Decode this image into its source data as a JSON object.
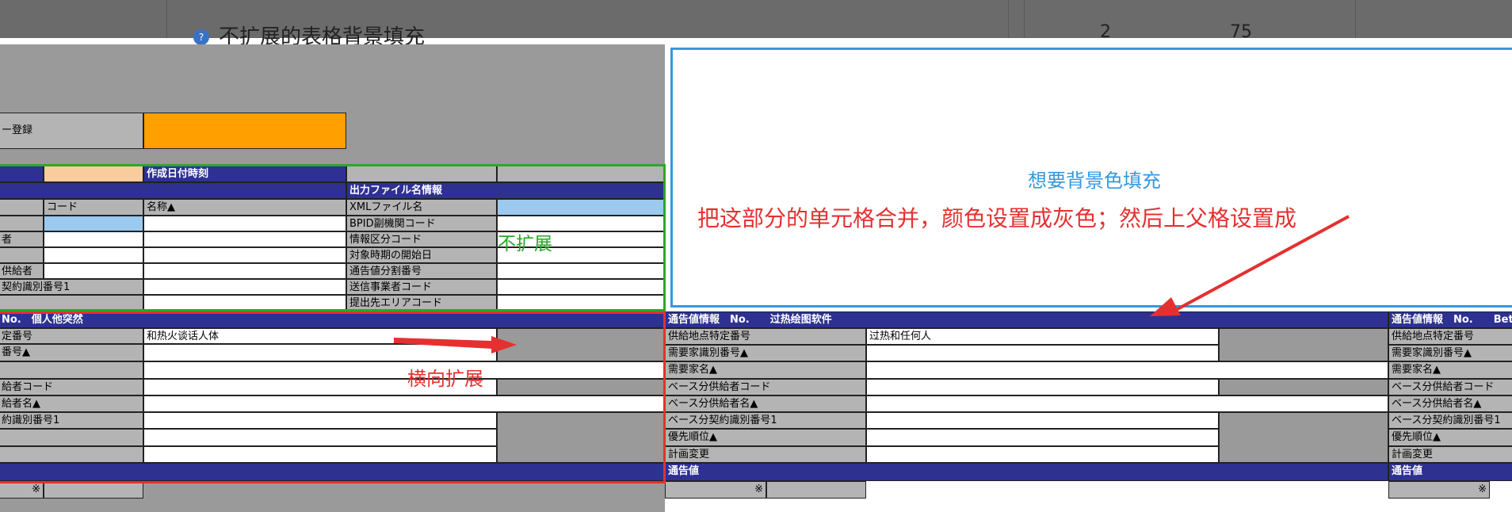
{
  "background_header": {
    "title": "不扩展的表格背景填充",
    "col_a": "2",
    "col_b": "75"
  },
  "left_sheet": {
    "register_label": "ー登録",
    "created_label": "作成日付時刻",
    "output_info_label": "出力ファイル名情報",
    "code_col": "コード",
    "name_col": "名称▲",
    "left_rows": [
      "者",
      "供給者",
      "契約識別番号1"
    ],
    "meta_rows": [
      "XMLファイル名",
      "BPID副機関コード",
      "情報区分コード",
      "対象時期の開始日",
      "通告値分割番号",
      "送信事業者コード",
      "提出先エリアコード"
    ],
    "notice_header": "No.　個人他突然",
    "notice_rows": [
      "定番号",
      "番号▲",
      "",
      "給者コード",
      "給者名▲",
      "約識別番号1",
      "",
      ""
    ],
    "notice_value": "和热火谈话人体",
    "mark": "※"
  },
  "middle_sheet": {
    "header": "通告値情報　No.　　过热绘图软件",
    "rows": [
      "供給地点特定番号",
      "需要家識別番号▲",
      "需要家名▲",
      "ベース分供給者コード",
      "ベース分供給者名▲",
      "ベース分契約識別番号1",
      "優先順位▲",
      "計画変更"
    ],
    "value": "过热和任何人",
    "footer": "通告値",
    "mark": "※"
  },
  "right_sheet": {
    "header": "通告値情報　No.　　Beth",
    "rows": [
      "供給地点特定番号",
      "需要家識別番号▲",
      "需要家名▲",
      "ベース分供給者コード",
      "ベース分供給者名▲",
      "ベース分契約識別番号1",
      "優先順位▲",
      "計画変更"
    ],
    "footer": "通告値",
    "mark": "※"
  },
  "annotations": {
    "wish": "想要背景色填充",
    "instruction": "把这部分的单元格合并，颜色设置成灰色；然后上父格设置成",
    "no_expand": "不扩展",
    "expand": "横向扩展"
  },
  "colors": {
    "navy_header": "#2e3192",
    "gray_cell": "#b4b4b4",
    "light_blue": "#9cc9ef",
    "orange": "#ff9f00",
    "annotation_red": "#e53030",
    "annotation_green": "#2aa82a",
    "annotation_blue": "#3399dd"
  }
}
